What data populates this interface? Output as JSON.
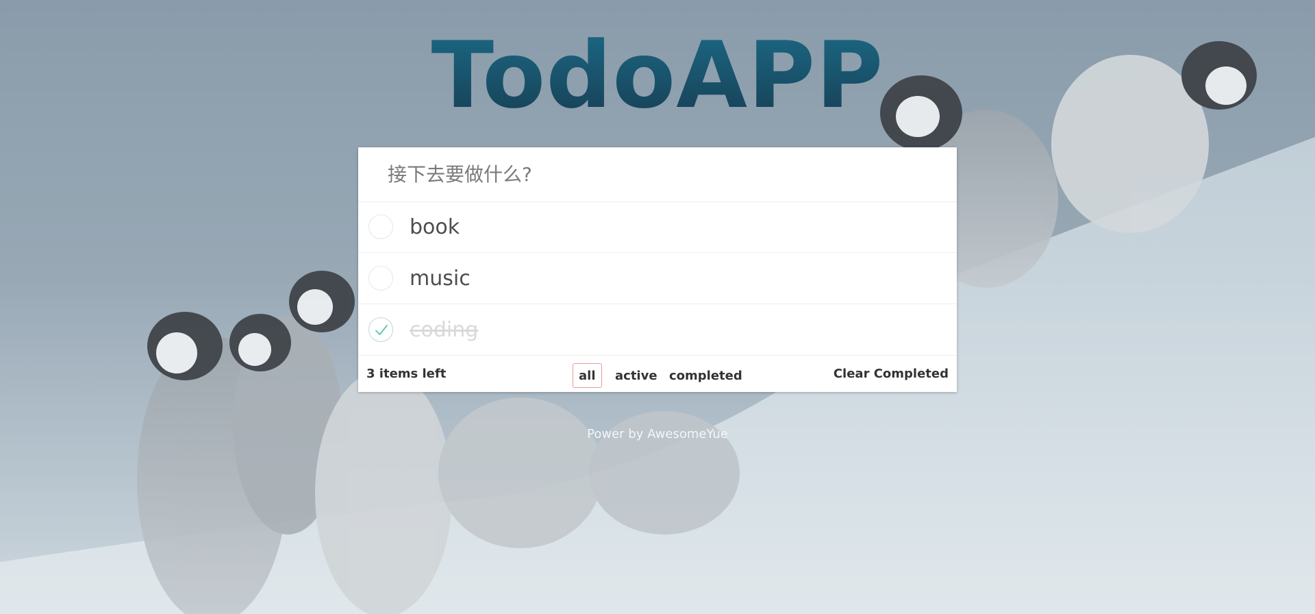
{
  "app": {
    "title": "TodoAPP"
  },
  "new_todo": {
    "placeholder": "接下去要做什么?",
    "value": ""
  },
  "todos": [
    {
      "label": "book",
      "completed": false
    },
    {
      "label": "music",
      "completed": false
    },
    {
      "label": "coding",
      "completed": true
    }
  ],
  "footer": {
    "items_left": "3 items left",
    "filters": [
      {
        "label": "all",
        "selected": true
      },
      {
        "label": "active",
        "selected": false
      },
      {
        "label": "completed",
        "selected": false
      }
    ],
    "clear_label": "Clear Completed"
  },
  "credit": "Power by AwesomeYue",
  "colors": {
    "title_top": "#1c6a86",
    "title_bottom": "#163d52",
    "selected_filter_border": "#e59b9b",
    "check_green": "#5dc2af",
    "completed_text": "#d9d9d9"
  },
  "icons": {
    "toggle_unchecked": "circle-icon",
    "toggle_checked": "check-circle-icon"
  }
}
